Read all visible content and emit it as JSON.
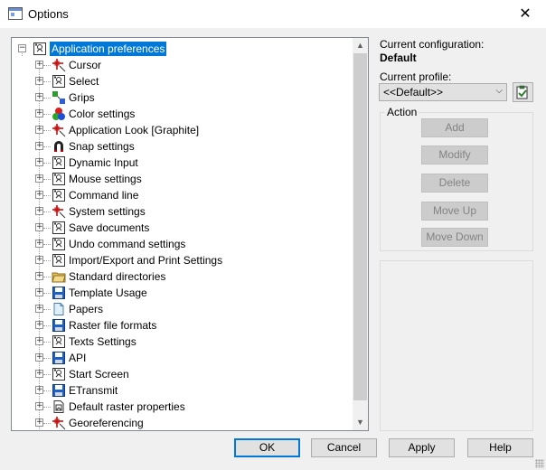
{
  "window": {
    "title": "Options",
    "close_glyph": "✕"
  },
  "tree": {
    "root": {
      "label": "Application preferences",
      "icon": "settings-gear-icon"
    },
    "items": [
      {
        "label": "Cursor",
        "icon": "cursor-icon"
      },
      {
        "label": "Select",
        "icon": "settings-gear-icon"
      },
      {
        "label": "Grips",
        "icon": "grips-icon"
      },
      {
        "label": "Color settings",
        "icon": "color-icon"
      },
      {
        "label": "Application Look [Graphite]",
        "icon": "cursor-icon"
      },
      {
        "label": "Snap settings",
        "icon": "magnet-icon"
      },
      {
        "label": "Dynamic Input",
        "icon": "settings-gear-icon"
      },
      {
        "label": "Mouse settings",
        "icon": "settings-gear-icon"
      },
      {
        "label": "Command line",
        "icon": "settings-gear-icon"
      },
      {
        "label": "System settings",
        "icon": "cursor-icon"
      },
      {
        "label": "Save documents",
        "icon": "settings-gear-icon"
      },
      {
        "label": "Undo command settings",
        "icon": "settings-gear-icon"
      },
      {
        "label": "Import/Export and Print Settings",
        "icon": "settings-gear-icon"
      },
      {
        "label": "Standard directories",
        "icon": "folder-icon"
      },
      {
        "label": "Template Usage",
        "icon": "floppy-icon"
      },
      {
        "label": "Papers",
        "icon": "paper-icon"
      },
      {
        "label": "Raster file formats",
        "icon": "floppy-icon"
      },
      {
        "label": "Texts Settings",
        "icon": "settings-gear-icon"
      },
      {
        "label": "API",
        "icon": "floppy-icon"
      },
      {
        "label": "Start Screen",
        "icon": "settings-gear-icon"
      },
      {
        "label": "ETransmit",
        "icon": "floppy-icon"
      },
      {
        "label": "Default raster properties",
        "icon": "raster-doc-icon"
      },
      {
        "label": "Georeferencing",
        "icon": "cursor-icon"
      }
    ]
  },
  "config": {
    "current_configuration_label": "Current configuration:",
    "current_configuration_value": "Default",
    "current_profile_label": "Current profile:",
    "current_profile_value": "<<Default>>"
  },
  "action": {
    "title": "Action",
    "buttons": [
      "Add",
      "Modify",
      "Delete",
      "Move Up",
      "Move Down"
    ]
  },
  "footer": {
    "ok": "OK",
    "cancel": "Cancel",
    "apply": "Apply",
    "help": "Help"
  },
  "colors": {
    "selection": "#0078d7",
    "default_button_border": "#0078d7"
  }
}
